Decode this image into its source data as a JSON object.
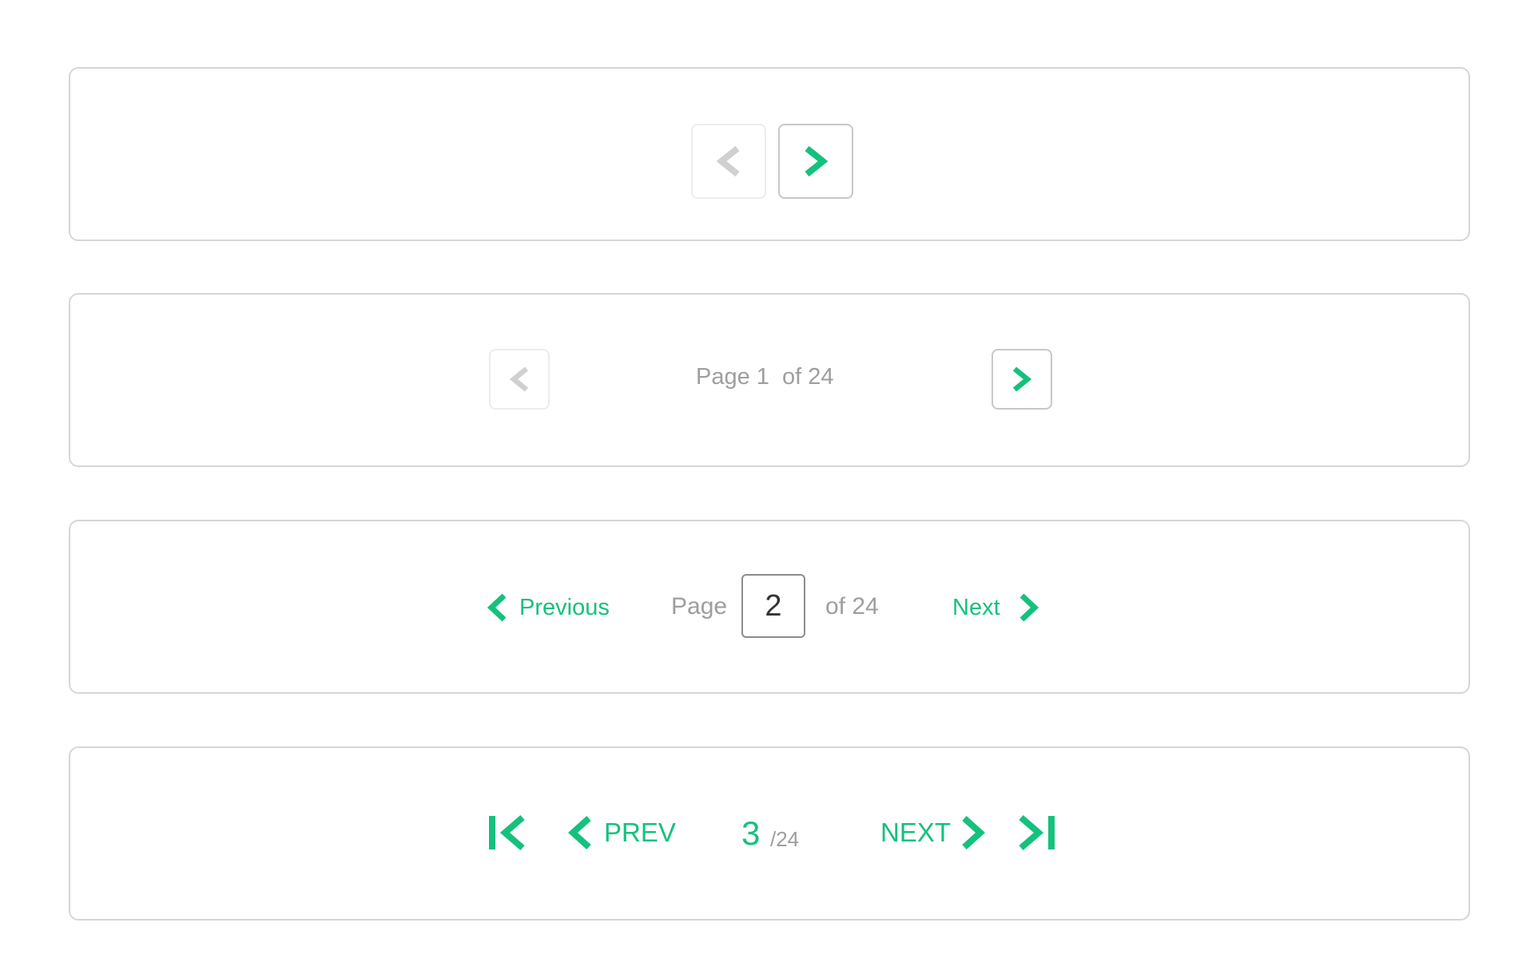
{
  "colors": {
    "accent": "#14c17d",
    "muted_text": "#9e9e9e",
    "disabled_icon": "#d0d0d0",
    "border": "#d6d6d6"
  },
  "panel1": {
    "prev_icon": "chevron-left-icon",
    "next_icon": "chevron-right-icon",
    "prev_disabled": true
  },
  "panel2": {
    "status": "Page 1  of 24",
    "prev_disabled": true
  },
  "panel3": {
    "previous_label": "Previous",
    "page_label": "Page",
    "page_value": "2",
    "of_total": "of 24",
    "next_label": "Next"
  },
  "panel4": {
    "first_icon": "first-page-icon",
    "prev_label": "PREV",
    "current_page": "3",
    "total": "/24",
    "next_label": "NEXT",
    "last_icon": "last-page-icon"
  }
}
